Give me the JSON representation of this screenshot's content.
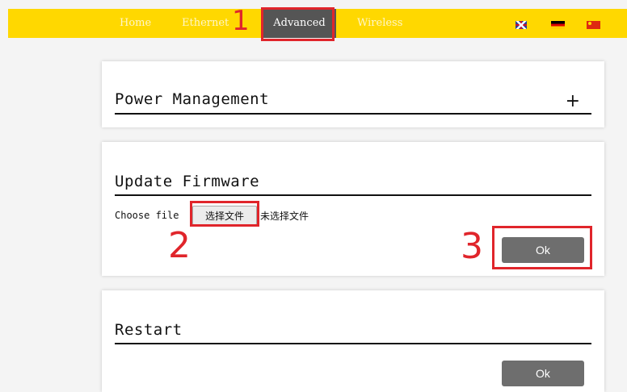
{
  "nav": {
    "items": [
      {
        "label": "Home"
      },
      {
        "label": "Ethernet"
      },
      {
        "label": "Advanced",
        "active": true
      },
      {
        "label": "Wireless"
      }
    ],
    "languages": [
      {
        "name": "English",
        "icon": "uk-flag-icon"
      },
      {
        "name": "Deutsch",
        "icon": "germany-flag-icon"
      },
      {
        "name": "Chinese",
        "icon": "china-flag-icon"
      }
    ]
  },
  "annotations": {
    "one": "1",
    "two": "2",
    "three": "3",
    "color": "#e0252b"
  },
  "panels": {
    "power": {
      "title": "Power Management",
      "expand": "+"
    },
    "firmware": {
      "title": "Update Firmware",
      "choose_label": "Choose file",
      "file_button": "选择文件",
      "file_status": "未选择文件",
      "ok": "Ok"
    },
    "restart": {
      "title": "Restart",
      "ok": "Ok"
    }
  },
  "colors": {
    "header": "#ffd800",
    "active_tab": "#555555",
    "button": "#6e6e6e",
    "highlight": "#e0252b"
  }
}
